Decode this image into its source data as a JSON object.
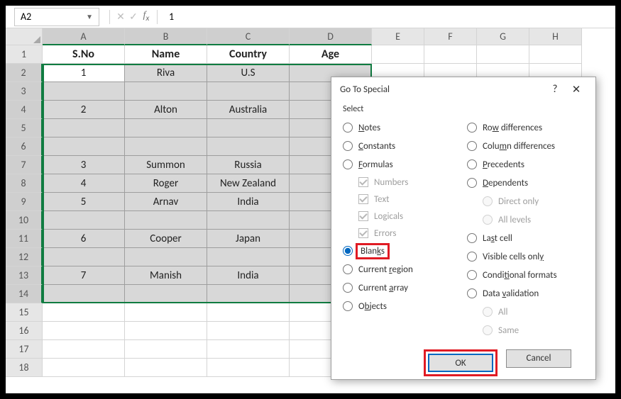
{
  "formula_bar": {
    "namebox": "A2",
    "formula": "1"
  },
  "columns": [
    "A",
    "B",
    "C",
    "D",
    "E",
    "F",
    "G",
    "H"
  ],
  "row_numbers": [
    1,
    2,
    3,
    4,
    5,
    6,
    7,
    8,
    9,
    10,
    11,
    12,
    13,
    14,
    15,
    16,
    17,
    18
  ],
  "headers": {
    "sno": "S.No",
    "name": "Name",
    "country": "Country",
    "age": "Age"
  },
  "data": {
    "r2": {
      "sno": "1",
      "name": "Riva",
      "country": "U.S"
    },
    "r3": {
      "sno": "",
      "name": "",
      "country": ""
    },
    "r4": {
      "sno": "2",
      "name": "Alton",
      "country": "Australia"
    },
    "r5": {
      "sno": "",
      "name": "",
      "country": ""
    },
    "r6": {
      "sno": "",
      "name": "",
      "country": ""
    },
    "r7": {
      "sno": "3",
      "name": "Summon",
      "country": "Russia"
    },
    "r8": {
      "sno": "4",
      "name": "Roger",
      "country": "New Zealand"
    },
    "r9": {
      "sno": "5",
      "name": "Arnav",
      "country": "India"
    },
    "r10": {
      "sno": "",
      "name": "",
      "country": ""
    },
    "r11": {
      "sno": "6",
      "name": "Cooper",
      "country": "Japan"
    },
    "r12": {
      "sno": "",
      "name": "",
      "country": ""
    },
    "r13": {
      "sno": "7",
      "name": "Manish",
      "country": "India"
    },
    "r14": {
      "sno": "",
      "name": "",
      "country": ""
    }
  },
  "dialog": {
    "title": "Go To Special",
    "select_label": "Select",
    "options_left": {
      "notes": "otes",
      "notes_u": "N",
      "constants": "onstants",
      "constants_u": "C",
      "formulas": "ormulas",
      "formulas_u": "F",
      "numbers": "Numbers",
      "text": "Text",
      "logicals": "Logicals",
      "errors": "Errors",
      "blanks": "s",
      "blanks_pre": "Blan",
      "blanks_u": "k",
      "current_region": "Current ",
      "current_region_u": "r",
      "current_region_post": "egion",
      "current_array": "Current ",
      "current_array_u": "a",
      "current_array_post": "rray",
      "objects": "O",
      "objects_u": "b",
      "objects_post": "jects"
    },
    "options_right": {
      "row_diff": "Ro",
      "row_diff_u": "w",
      "row_diff_post": " differences",
      "col_diff": "Colu",
      "col_diff_u": "m",
      "col_diff_post": "n differences",
      "precedents": "recedents",
      "precedents_u": "P",
      "dependents": "ependents",
      "dependents_u": "D",
      "direct": "Direct only",
      "all_levels": "All levels",
      "last_cell": "La",
      "last_cell_u": "s",
      "last_cell_post": "t cell",
      "visible": "Visible cells onl",
      "visible_u": "y",
      "cond": "Condi",
      "cond_u": "t",
      "cond_post": "ional formats",
      "datav": "Data ",
      "datav_u": "v",
      "datav_post": "alidation",
      "all": "All",
      "same": "Same"
    },
    "ok": "OK",
    "cancel": "Cancel"
  }
}
